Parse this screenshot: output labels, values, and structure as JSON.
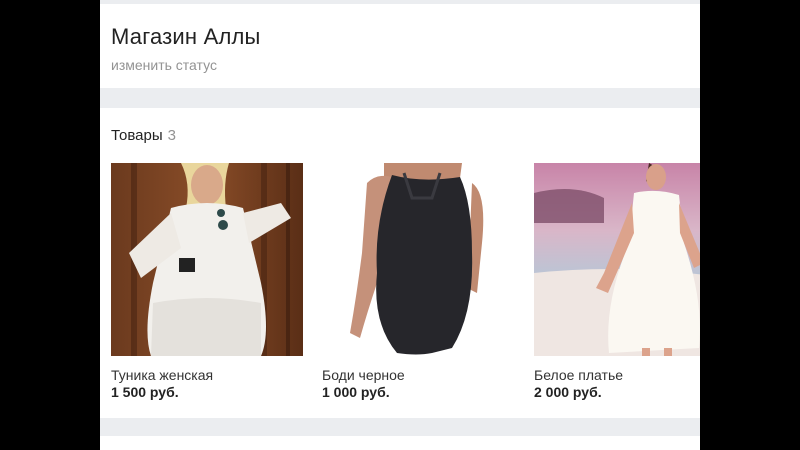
{
  "shop": {
    "name": "Магазин Аллы",
    "status_link": "изменить статус"
  },
  "products": {
    "heading": "Товары",
    "count": "3",
    "items": [
      {
        "title": "Туника женская",
        "price": "1 500 руб."
      },
      {
        "title": "Боди черное",
        "price": "1 000 руб."
      },
      {
        "title": "Белое платье",
        "price": "2 000 руб."
      }
    ]
  },
  "colors": {
    "page_background": "#ebedf0",
    "card_background": "#ffffff",
    "secondary_text": "#939393",
    "letterbox": "#000000"
  }
}
